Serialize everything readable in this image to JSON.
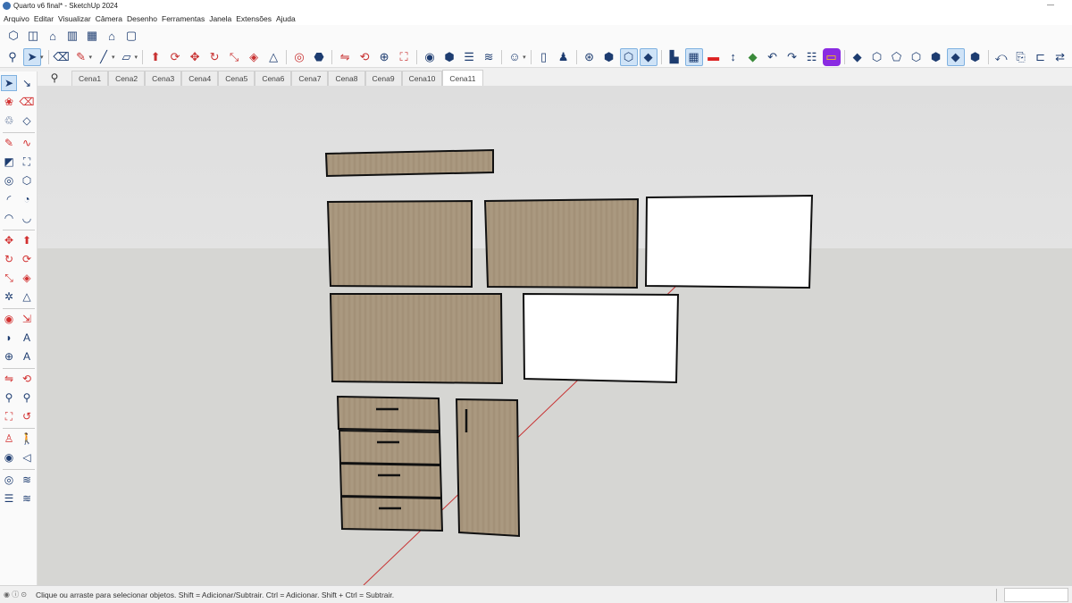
{
  "window": {
    "title": "Quarto v6 final* - SketchUp 2024",
    "minimize_glyph": "—"
  },
  "menu": [
    "Arquivo",
    "Editar",
    "Visualizar",
    "Câmera",
    "Desenho",
    "Ferramentas",
    "Janela",
    "Extensões",
    "Ajuda"
  ],
  "toolbar_row1": [
    "iso-view-icon",
    "top-view-icon",
    "front-view-icon",
    "right-view-icon",
    "back-view-icon",
    "left-view-icon",
    "bottom-view-icon"
  ],
  "toolbar_row2_icons": {
    "search": "⚲",
    "select": "➤",
    "eraser": "⌫",
    "pencil": "✎",
    "line": "╱",
    "rect": "▭",
    "push": "⬆",
    "orbit": "⟲",
    "move": "✥",
    "rotate": "↻",
    "scale": "⤡",
    "offset": "◈",
    "paint": "⬣",
    "tape": "⌇",
    "dim": "↔",
    "zoom": "⊕",
    "zoom_ext": "⛶"
  },
  "scenes": {
    "search_glyph": "⚲",
    "tabs": [
      "Cena1",
      "Cena2",
      "Cena3",
      "Cena4",
      "Cena5",
      "Cena6",
      "Cena7",
      "Cena8",
      "Cena9",
      "Cena10",
      "Cena11"
    ],
    "active": "Cena11"
  },
  "statusbar": {
    "text": "Clique ou arraste para selecionar objetos. Shift = Adicionar/Subtrair. Ctrl = Adicionar. Shift + Ctrl = Subtrair.",
    "icons": "◉ ⓘ ⊙",
    "measure_value": ""
  },
  "colors": {
    "wood": "#a8967d",
    "wood_dark": "#8f7d65",
    "white_panel": "#ffffff",
    "axis_red": "#c83232",
    "accent_blue": "#1d3c70",
    "active_tool_bg": "#cfe3f7"
  }
}
